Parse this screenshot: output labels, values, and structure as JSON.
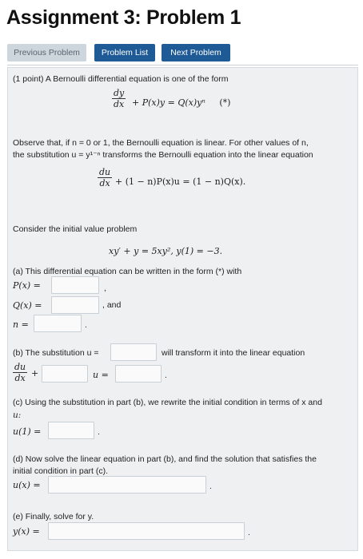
{
  "header": {
    "title": "Assignment 3: Problem 1"
  },
  "nav": {
    "previous": "Previous Problem",
    "list": "Problem List",
    "next": "Next Problem"
  },
  "problem": {
    "intro_points": "(1 point) A Bernoulli differential equation is one of the form",
    "bernoulli_rest": "+ P(x)y = Q(x)yⁿ",
    "bernoulli_tag": "(*)",
    "observe_1": "Observe that, if n = 0 or 1, the Bernoulli equation is linear. For other values of n,",
    "observe_2": "the substitution u = y¹⁻ⁿ transforms the Bernoulli equation into the linear equation",
    "linear_rest": "+ (1 − n)P(x)u = (1 − n)Q(x).",
    "frac_num_dy": "dy",
    "frac_num_du": "du",
    "frac_den": "dx",
    "ivp_intro": "Consider the initial value problem",
    "ivp": "xy′ + y = 5xy²,  y(1) = −3."
  },
  "parts": {
    "a_text": "(a) This differential equation can be written in the form (*) with",
    "a_P": "P(x) =",
    "a_Q": "Q(x) =",
    "a_n": "n =",
    "a_and": ", and",
    "a_comma": ",",
    "a_period": ".",
    "b_text": "(b) The substitution u =",
    "b_after": "will transform it into the linear equation",
    "b_plus": "+",
    "b_u": "u =",
    "b_period": ".",
    "c_text_1": "(c) Using the substitution in part (b), we rewrite the initial condition in terms of x and",
    "c_text_2": "u:",
    "c_u1": "u(1) =",
    "c_period": ".",
    "d_text_1": "(d) Now solve the linear equation in part (b), and find the solution that satisfies the",
    "d_text_2": "initial condition in part (c).",
    "d_ux": "u(x) =",
    "d_period": ".",
    "e_text": "(e) Finally, solve for y.",
    "e_yx": "y(x) =",
    "e_period": "."
  }
}
